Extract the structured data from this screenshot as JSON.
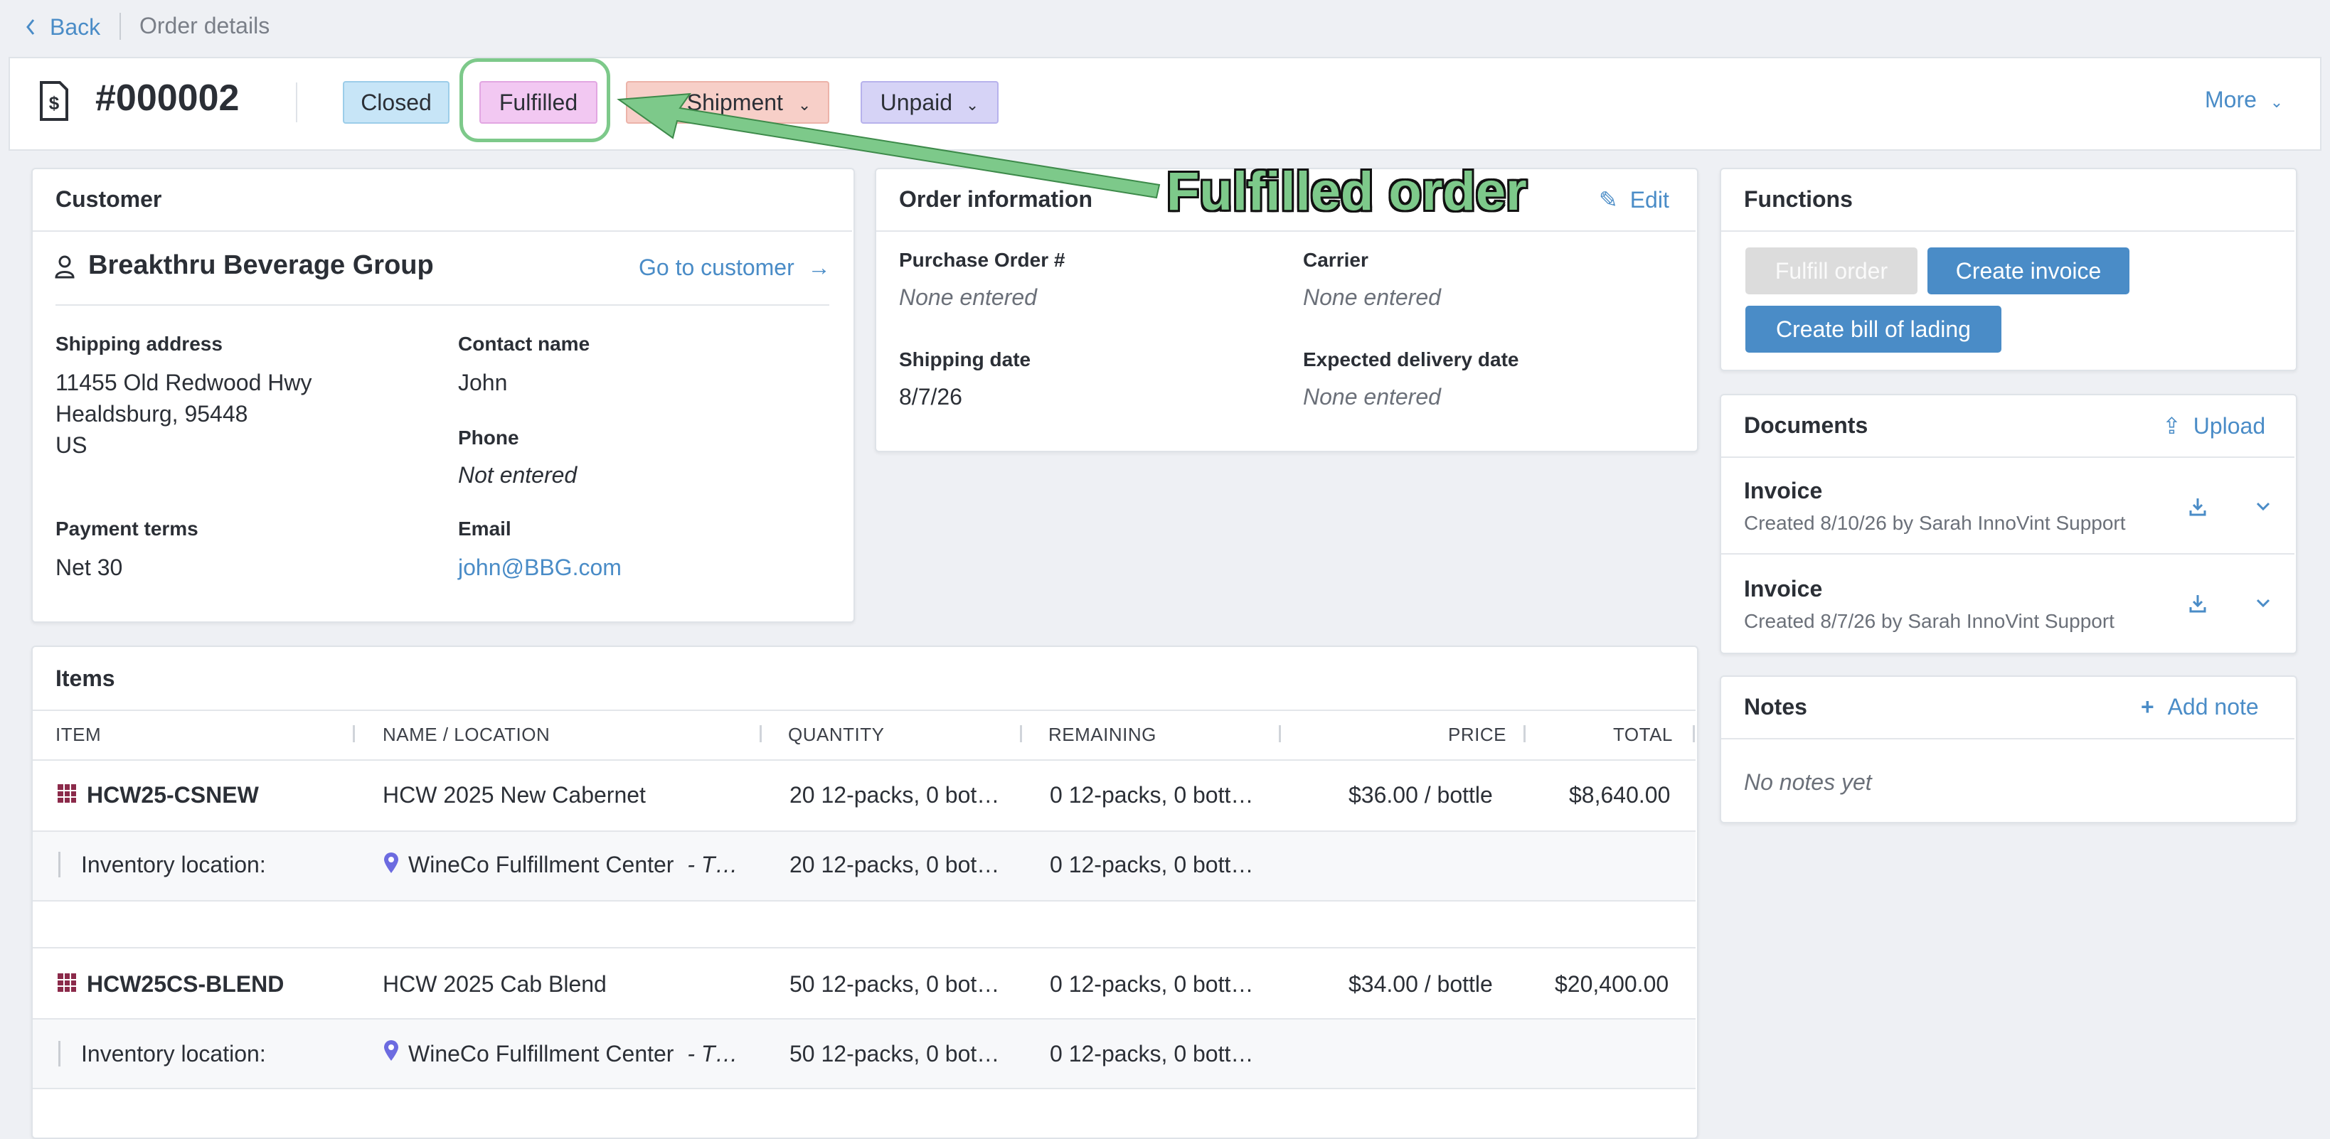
{
  "nav": {
    "back_label": "Back",
    "breadcrumb": "Order details"
  },
  "order": {
    "number": "#000002",
    "badges": {
      "closed": "Closed",
      "fulfilled": "Fulfilled",
      "shipment": "Shipment",
      "unpaid": "Unpaid"
    },
    "more_label": "More"
  },
  "annotation": {
    "text": "Fulfilled order"
  },
  "customer": {
    "title": "Customer",
    "name": "Breakthru Beverage Group",
    "go_link": "Go to customer",
    "shipping_label": "Shipping address",
    "address_line1": "11455 Old Redwood Hwy",
    "address_line2": "Healdsburg, 95448",
    "address_line3": "US",
    "contact_label": "Contact name",
    "contact_value": "John",
    "phone_label": "Phone",
    "phone_value": "Not entered",
    "payment_label": "Payment terms",
    "payment_value": "Net 30",
    "email_label": "Email",
    "email_value": "john@BBG.com"
  },
  "order_info": {
    "title": "Order information",
    "edit_label": "Edit",
    "po_label": "Purchase Order #",
    "po_value": "None entered",
    "carrier_label": "Carrier",
    "carrier_value": "None entered",
    "ship_date_label": "Shipping date",
    "ship_date_value": "8/7/26",
    "delivery_label": "Expected delivery date",
    "delivery_value": "None entered"
  },
  "functions": {
    "title": "Functions",
    "fulfill": "Fulfill order",
    "create_invoice": "Create invoice",
    "create_bol": "Create bill of lading"
  },
  "documents": {
    "title": "Documents",
    "upload": "Upload",
    "items": [
      {
        "name": "Invoice",
        "meta": "Created 8/10/26 by Sarah InnoVint Support"
      },
      {
        "name": "Invoice",
        "meta": "Created 8/7/26 by Sarah InnoVint Support"
      }
    ]
  },
  "notes": {
    "title": "Notes",
    "add": "Add note",
    "empty": "No notes yet"
  },
  "items": {
    "title": "Items",
    "columns": {
      "item": "ITEM",
      "name": "NAME / LOCATION",
      "quantity": "QUANTITY",
      "remaining": "REMAINING",
      "price": "PRICE",
      "total": "TOTAL"
    },
    "rows": [
      {
        "code": "HCW25-CSNEW",
        "name": "HCW 2025 New Cabernet",
        "quantity": "20 12-packs, 0 bot…",
        "remaining": "0 12-packs, 0 bott…",
        "price": "$36.00 / bottle",
        "total": "$8,640.00",
        "loc_label": "Inventory location:",
        "loc_name": "WineCo Fulfillment Center",
        "loc_suffix": "- T…",
        "loc_quantity": "20 12-packs, 0 bot…",
        "loc_remaining": "0 12-packs, 0 bott…"
      },
      {
        "code": "HCW25CS-BLEND",
        "name": "HCW 2025 Cab Blend",
        "quantity": "50 12-packs, 0 bot…",
        "remaining": "0 12-packs, 0 bott…",
        "price": "$34.00 / bottle",
        "total": "$20,400.00",
        "loc_label": "Inventory location:",
        "loc_name": "WineCo Fulfillment Center",
        "loc_suffix": "- T…",
        "loc_quantity": "50 12-packs, 0 bot…",
        "loc_remaining": "0 12-packs, 0 bott…"
      }
    ]
  },
  "colors": {
    "closed_bg": "#c7e5f7",
    "fulfilled_bg": "#f2c8f2",
    "shipment_bg": "#f7cfc8",
    "unpaid_bg": "#d6d3f6",
    "primary": "#4a8cc7",
    "disabled": "#dcdcdc",
    "annotation_green": "#7dc98a"
  }
}
